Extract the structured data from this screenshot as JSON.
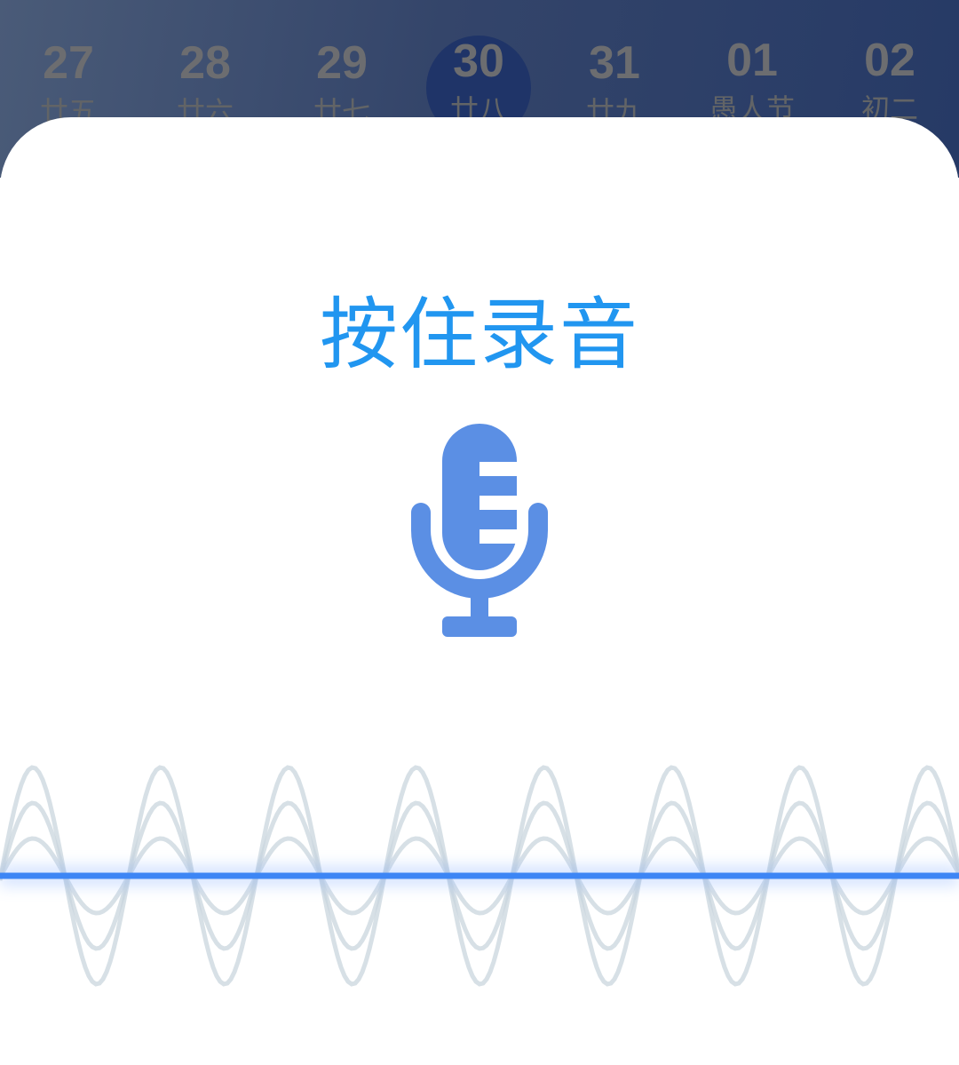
{
  "calendar_strip": {
    "dates": [
      {
        "day": "27",
        "lunar": "廿五",
        "selected": false
      },
      {
        "day": "28",
        "lunar": "廿六",
        "selected": false
      },
      {
        "day": "29",
        "lunar": "廿七",
        "selected": false
      },
      {
        "day": "30",
        "lunar": "廿八",
        "selected": true
      },
      {
        "day": "31",
        "lunar": "廿九",
        "selected": false
      },
      {
        "day": "01",
        "lunar": "愚人节",
        "selected": false
      },
      {
        "day": "02",
        "lunar": "初二",
        "selected": false
      }
    ]
  },
  "record_sheet": {
    "title": "按住录音",
    "mic_icon": "microphone-icon",
    "colors": {
      "title": "#2196f0",
      "mic": "#5b8fe4",
      "wave_line": "#3d86f5",
      "wave_ghost": "#c9d5de"
    }
  }
}
